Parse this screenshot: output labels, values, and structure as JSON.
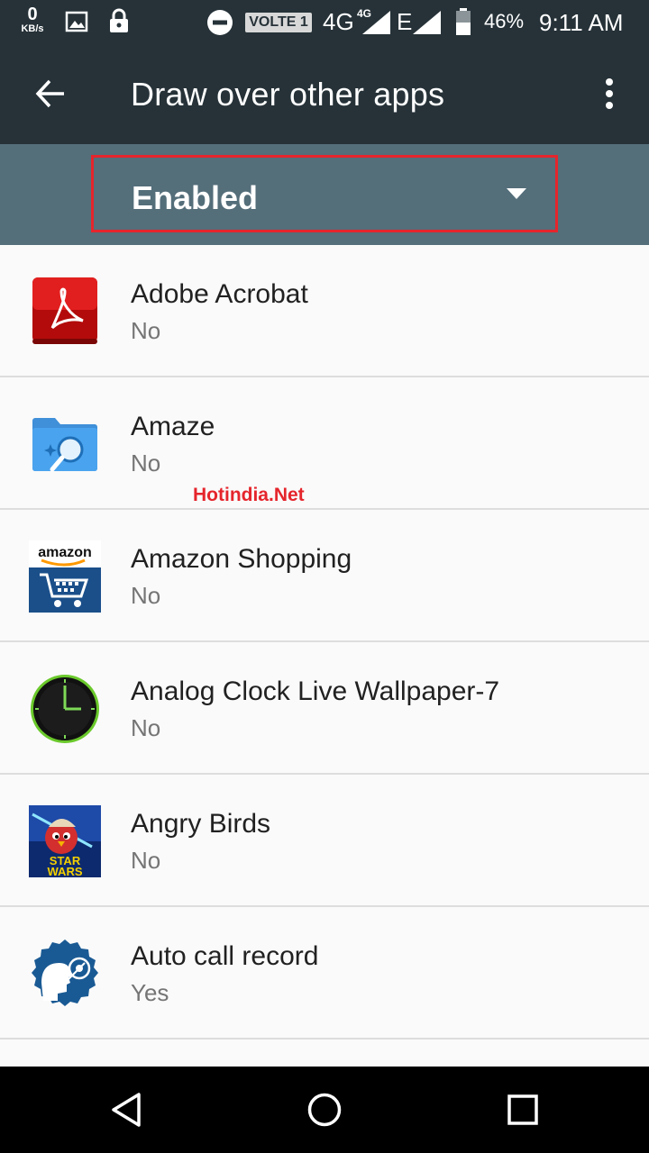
{
  "status_bar": {
    "speed_value": "0",
    "speed_unit": "KB/s",
    "volte_label": "VOLTE 1",
    "network_4g": "4G",
    "network_4g_small": "4G",
    "network_e": "E",
    "battery_percent": "46%",
    "time": "9:11 AM",
    "icons": [
      "image-icon",
      "lock-icon",
      "do-not-disturb-icon",
      "signal-icon",
      "battery-icon"
    ]
  },
  "toolbar": {
    "title": "Draw over other apps",
    "back_icon": "arrow-back-icon",
    "menu_icon": "more-vert-icon"
  },
  "filter": {
    "selected": "Enabled",
    "arrow_icon": "dropdown-arrow-icon",
    "highlight_color": "#e5252c"
  },
  "watermark": "Hotindia.Net",
  "apps": [
    {
      "name": "Adobe Acrobat",
      "status": "No",
      "icon": "adobe-acrobat-icon"
    },
    {
      "name": "Amaze",
      "status": "No",
      "icon": "amaze-folder-icon"
    },
    {
      "name": "Amazon Shopping",
      "status": "No",
      "icon": "amazon-cart-icon"
    },
    {
      "name": "Analog Clock Live Wallpaper-7",
      "status": "No",
      "icon": "analog-clock-icon"
    },
    {
      "name": "Angry Birds",
      "status": "No",
      "icon": "angry-birds-icon"
    },
    {
      "name": "Auto call record",
      "status": "Yes",
      "icon": "auto-call-record-icon"
    }
  ],
  "app_icon_texts": {
    "amazon": "amazon",
    "star": "STAR",
    "wars": "WARS"
  },
  "colors": {
    "toolbar": "#263238",
    "filter_bar": "#546e7a",
    "list_bg": "#fafafa",
    "secondary_text": "#757575"
  },
  "nav_bar": {
    "icons": [
      "back-triangle-icon",
      "home-circle-icon",
      "recents-square-icon"
    ]
  }
}
